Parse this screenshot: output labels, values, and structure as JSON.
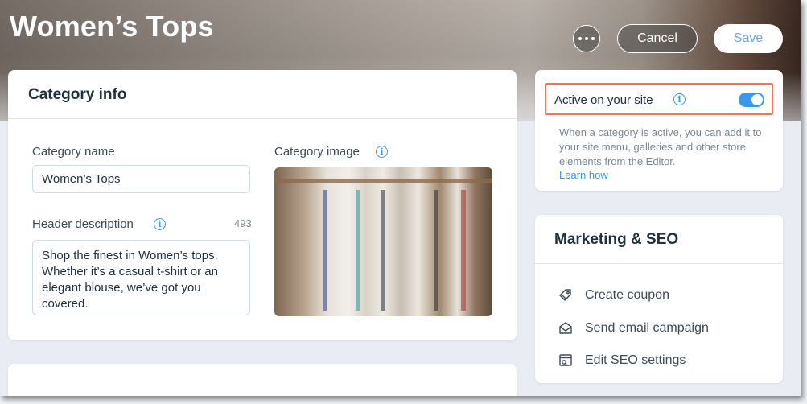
{
  "header": {
    "title": "Women’s Tops",
    "more_label": "More actions",
    "cancel_label": "Cancel",
    "save_label": "Save"
  },
  "category_info": {
    "title": "Category info",
    "name_label": "Category name",
    "name_value": "Women’s Tops",
    "description_label": "Header description",
    "description_counter": "493",
    "description_value": "Shop the finest in Women’s tops. Whether it’s a casual t-shirt or an elegant blouse, we’ve got you covered.",
    "image_label": "Category image"
  },
  "active_panel": {
    "label": "Active on your site",
    "enabled": true,
    "help_text": "When a category is active, you can add it to your site menu, galleries and other store elements from the Editor.",
    "learn_more": "Learn how"
  },
  "marketing": {
    "title": "Marketing & SEO",
    "items": [
      {
        "label": "Create coupon",
        "icon": "coupon-icon"
      },
      {
        "label": "Send email campaign",
        "icon": "email-icon"
      },
      {
        "label": "Edit SEO settings",
        "icon": "seo-icon"
      }
    ]
  },
  "colors": {
    "accent": "#3899ec",
    "highlight": "#f0735a"
  }
}
